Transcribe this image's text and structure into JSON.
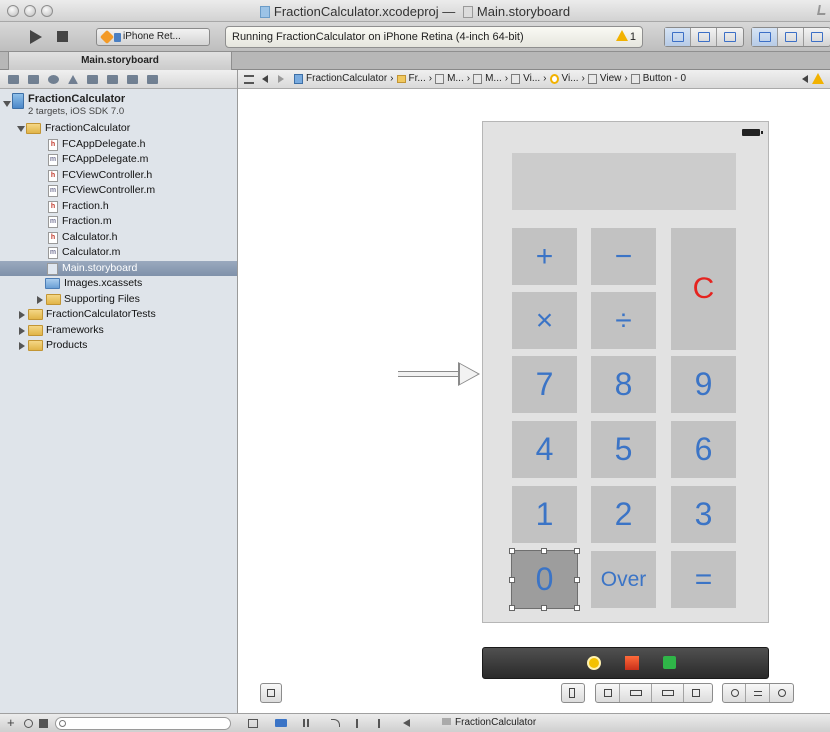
{
  "window": {
    "title_project": "FractionCalculator.xcodeproj",
    "title_separator": "—",
    "title_file": "Main.storyboard"
  },
  "toolbar": {
    "scheme_label": "iPhone Ret...",
    "activity_text": "Running FractionCalculator on iPhone Retina (4-inch 64-bit)",
    "warning_count": "1"
  },
  "tab": {
    "label": "Main.storyboard"
  },
  "navigator": {
    "project_name": "FractionCalculator",
    "project_subtitle": "2 targets, iOS SDK 7.0",
    "items": [
      {
        "label": "FractionCalculator",
        "kind": "group",
        "expanded": true
      },
      {
        "label": "FCAppDelegate.h",
        "kind": "h"
      },
      {
        "label": "FCAppDelegate.m",
        "kind": "m"
      },
      {
        "label": "FCViewController.h",
        "kind": "h"
      },
      {
        "label": "FCViewController.m",
        "kind": "m"
      },
      {
        "label": "Fraction.h",
        "kind": "h"
      },
      {
        "label": "Fraction.m",
        "kind": "m"
      },
      {
        "label": "Calculator.h",
        "kind": "h"
      },
      {
        "label": "Calculator.m",
        "kind": "m"
      },
      {
        "label": "Main.storyboard",
        "kind": "storyboard",
        "selected": true
      },
      {
        "label": "Images.xcassets",
        "kind": "assets"
      },
      {
        "label": "Supporting Files",
        "kind": "group",
        "expanded": false
      },
      {
        "label": "FractionCalculatorTests",
        "kind": "group",
        "expanded": false
      },
      {
        "label": "Frameworks",
        "kind": "group",
        "expanded": false
      },
      {
        "label": "Products",
        "kind": "group",
        "expanded": false
      }
    ]
  },
  "jumpbar": {
    "crumbs": [
      "FractionCalculator",
      "Fr...",
      "M...",
      "M...",
      "Vi...",
      "Vi...",
      "View",
      "Button - 0"
    ]
  },
  "calculator": {
    "buttons": {
      "plus": "+",
      "minus": "−",
      "clear": "C",
      "times": "×",
      "divide": "÷",
      "seven": "7",
      "eight": "8",
      "nine": "9",
      "four": "4",
      "five": "5",
      "six": "6",
      "one": "1",
      "two": "2",
      "three": "3",
      "zero": "0",
      "over": "Over",
      "equals": "="
    },
    "accent_color": "#3b74c6",
    "clear_color": "#e5231f"
  },
  "debugbar": {
    "target": "FractionCalculator"
  },
  "icons": {
    "run": "play-icon",
    "stop": "stop-icon",
    "warning": "warning-icon",
    "editor_standard": "standard-editor-icon",
    "editor_assistant": "assistant-editor-icon",
    "editor_version": "version-editor-icon",
    "view_navigator": "navigator-view-icon",
    "view_debug": "debug-view-icon",
    "view_utilities": "utilities-view-icon"
  }
}
